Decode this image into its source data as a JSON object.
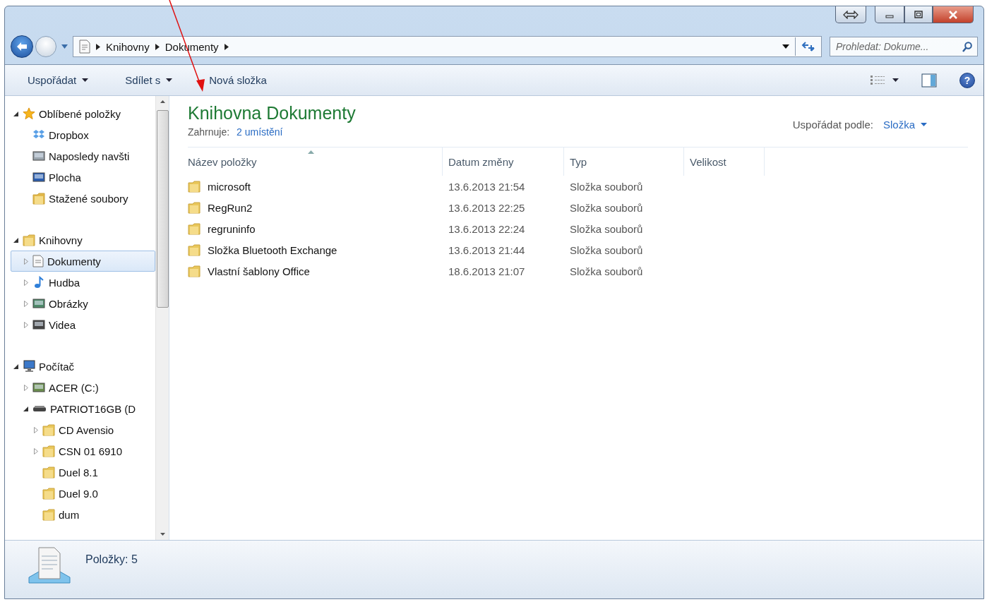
{
  "address_bar": {
    "crumbs": [
      "Knihovny",
      "Dokumenty"
    ]
  },
  "search": {
    "placeholder": "Prohledat: Dokume..."
  },
  "help": {
    "label": "?"
  },
  "toolbar": {
    "items": [
      {
        "label": "Uspořádat",
        "dropdown": true
      },
      {
        "label": "Sdílet s",
        "dropdown": true
      },
      {
        "label": "Nová složka",
        "dropdown": false
      }
    ]
  },
  "sidebar": {
    "groups": [
      {
        "label": "Oblíbené položky",
        "kind": "star",
        "has_children": true,
        "expanded": true,
        "selected": false,
        "children": [
          {
            "label": "Dropbox",
            "kind": "dropbox",
            "has_children": false,
            "selected": false
          },
          {
            "label": "Naposledy navšti",
            "kind": "recent",
            "has_children": false,
            "selected": false
          },
          {
            "label": "Plocha",
            "kind": "desktop",
            "has_children": false,
            "selected": false
          },
          {
            "label": "Stažené soubory",
            "kind": "downloads",
            "has_children": false,
            "selected": false
          }
        ]
      },
      {
        "label": "Knihovny",
        "kind": "library",
        "has_children": true,
        "expanded": true,
        "selected": false,
        "children": [
          {
            "label": "Dokumenty",
            "kind": "document",
            "has_children": true,
            "expanded": false,
            "selected": true
          },
          {
            "label": "Hudba",
            "kind": "music",
            "has_children": true,
            "expanded": false,
            "selected": false
          },
          {
            "label": "Obrázky",
            "kind": "pictures",
            "has_children": true,
            "expanded": false,
            "selected": false
          },
          {
            "label": "Videa",
            "kind": "video",
            "has_children": true,
            "expanded": false,
            "selected": false
          }
        ]
      },
      {
        "label": "Počítač",
        "kind": "computer",
        "has_children": true,
        "expanded": true,
        "selected": false,
        "children": [
          {
            "label": "ACER (C:)",
            "kind": "drive",
            "has_children": true,
            "expanded": false,
            "selected": false
          },
          {
            "label": "PATRIOT16GB (D",
            "kind": "usb",
            "has_children": true,
            "expanded": true,
            "selected": false,
            "children": [
              {
                "label": "CD Avensio",
                "kind": "folder",
                "has_children": true,
                "expanded": false,
                "selected": false
              },
              {
                "label": "CSN 01 6910",
                "kind": "folder",
                "has_children": true,
                "expanded": false,
                "selected": false
              },
              {
                "label": "Duel 8.1",
                "kind": "folder",
                "has_children": false,
                "selected": false
              },
              {
                "label": "Duel 9.0",
                "kind": "folder",
                "has_children": false,
                "selected": false
              },
              {
                "label": "dum",
                "kind": "folder",
                "has_children": false,
                "selected": false
              }
            ]
          }
        ]
      }
    ]
  },
  "library": {
    "title": "Knihovna Dokumenty",
    "includes_label": "Zahrnuje:",
    "includes_link": "2 umístění",
    "arrange_label": "Uspořádat podle:",
    "arrange_value": "Složka"
  },
  "table": {
    "columns": [
      "Název položky",
      "Datum změny",
      "Typ",
      "Velikost"
    ],
    "rows": [
      {
        "name": "microsoft",
        "date": "13.6.2013 21:54",
        "type": "Složka souborů"
      },
      {
        "name": "RegRun2",
        "date": "13.6.2013 22:25",
        "type": "Složka souborů"
      },
      {
        "name": "regruninfo",
        "date": "13.6.2013 22:24",
        "type": "Složka souborů"
      },
      {
        "name": "Složka Bluetooth Exchange",
        "date": "13.6.2013 21:44",
        "type": "Složka souborů"
      },
      {
        "name": "Vlastní šablony Office",
        "date": "18.6.2013 21:07",
        "type": "Složka souborů"
      }
    ]
  },
  "status_bar": {
    "text": "Položky: 5"
  }
}
